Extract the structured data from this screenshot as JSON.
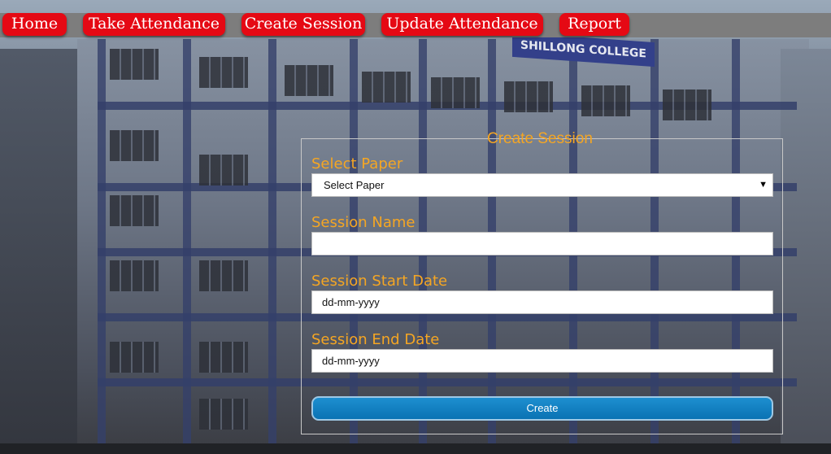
{
  "nav": {
    "items": [
      {
        "label": "Home"
      },
      {
        "label": "Take Attendance"
      },
      {
        "label": "Create Session"
      },
      {
        "label": "Update Attendance"
      },
      {
        "label": "Report"
      }
    ]
  },
  "background": {
    "sign_text": "SHILLONG COLLEGE"
  },
  "form": {
    "legend": "Create Session",
    "paper": {
      "label": "Select Paper",
      "selected": "Select Paper"
    },
    "session_name": {
      "label": "Session Name",
      "value": ""
    },
    "start_date": {
      "label": "Session Start Date",
      "placeholder": "dd-mm-yyyy"
    },
    "end_date": {
      "label": "Session End Date",
      "placeholder": "dd-mm-yyyy"
    },
    "submit_label": "Create"
  },
  "colors": {
    "nav_button": "#e50914",
    "label": "#f5a623",
    "submit": "#0a7bbf"
  }
}
